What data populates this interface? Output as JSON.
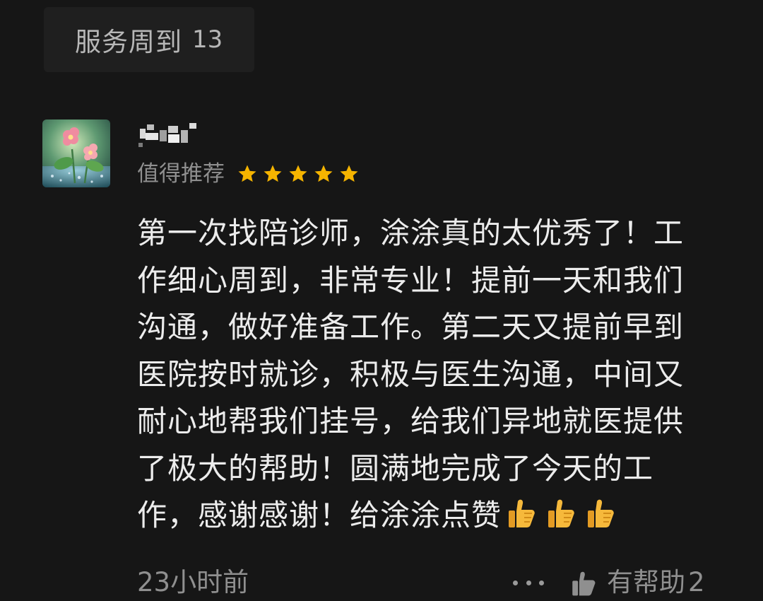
{
  "tag": {
    "label": "服务周到",
    "count": "13"
  },
  "review": {
    "rating_label": "值得推荐",
    "stars": 5,
    "star_color": "#f5b400",
    "text": "第一次找陪诊师，涂涂真的太优秀了！工作细心周到，非常专业！提前一天和我们沟通，做好准备工作。第二天又提前早到医院按时就诊，积极与医生沟通，中间又耐心地帮我们挂号，给我们异地就医提供了极大的帮助！圆满地完成了今天的工作，感谢感谢！给涂涂点赞",
    "emoji_icons": [
      "thumbs-up-emoji",
      "thumbs-up-emoji",
      "thumbs-up-emoji"
    ],
    "time": "23小时前",
    "helpful_label": "有帮助",
    "helpful_count": "2"
  }
}
